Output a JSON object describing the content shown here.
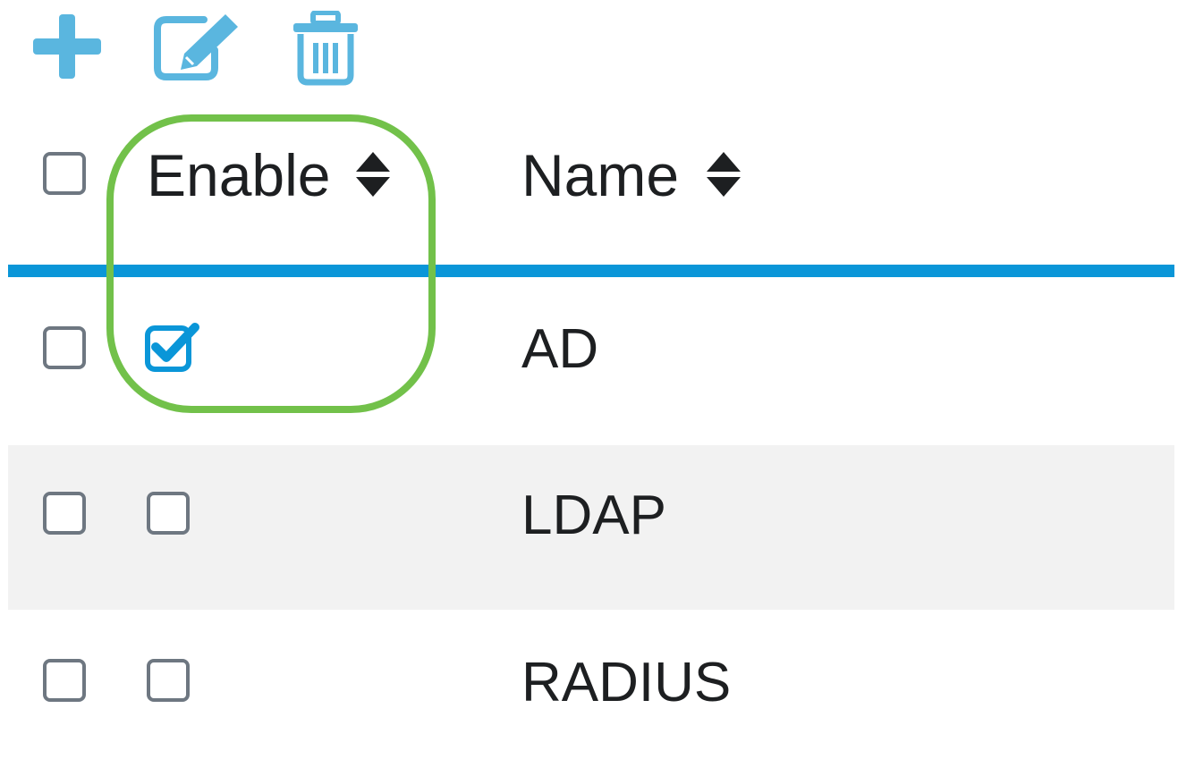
{
  "toolbar": {
    "add_icon": "plus-icon",
    "edit_icon": "edit-icon",
    "delete_icon": "trash-icon",
    "icon_color": "#5ab6df"
  },
  "table": {
    "columns": [
      {
        "label": "Enable",
        "sortable": true
      },
      {
        "label": "Name",
        "sortable": true
      }
    ],
    "rows": [
      {
        "enabled": true,
        "selected": false,
        "name": "AD"
      },
      {
        "enabled": false,
        "selected": false,
        "name": "LDAP"
      },
      {
        "enabled": false,
        "selected": false,
        "name": "RADIUS"
      }
    ],
    "header_rule_color": "#0a96d8",
    "alt_row_color": "#f2f2f2"
  },
  "highlight": {
    "color": "#72c14a",
    "target": "Enable column"
  }
}
